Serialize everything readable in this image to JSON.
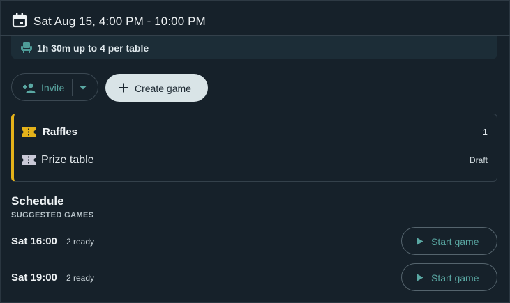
{
  "header": {
    "title": "Sat Aug 15, 4:00 PM - 10:00 PM",
    "icon": "calendar-icon"
  },
  "info_bar": {
    "duration": "1h 30m",
    "separator": "·",
    "capacity": "up to 4 per table",
    "icon": "seat-icon"
  },
  "actions": {
    "invite_label": "Invite",
    "create_label": "Create game"
  },
  "prizes": [
    {
      "label": "Raffles",
      "value": "1",
      "icon": "ticket-icon",
      "icon_color": "#e4b21a"
    },
    {
      "label": "Prize table",
      "value": "Draft",
      "icon": "ticket-icon",
      "icon_color": "#c8c8d6"
    }
  ],
  "schedule": {
    "title": "Schedule",
    "subtitle": "SUGGESTED GAMES",
    "slots": [
      {
        "time": "Sat 16:00",
        "ready": "2 ready",
        "action": "Start game"
      },
      {
        "time": "Sat 19:00",
        "ready": "2 ready",
        "action": "Start game"
      }
    ]
  },
  "colors": {
    "background": "#16212a",
    "accent_teal": "#5aa8a3",
    "accent_yellow": "#e4b21a"
  }
}
